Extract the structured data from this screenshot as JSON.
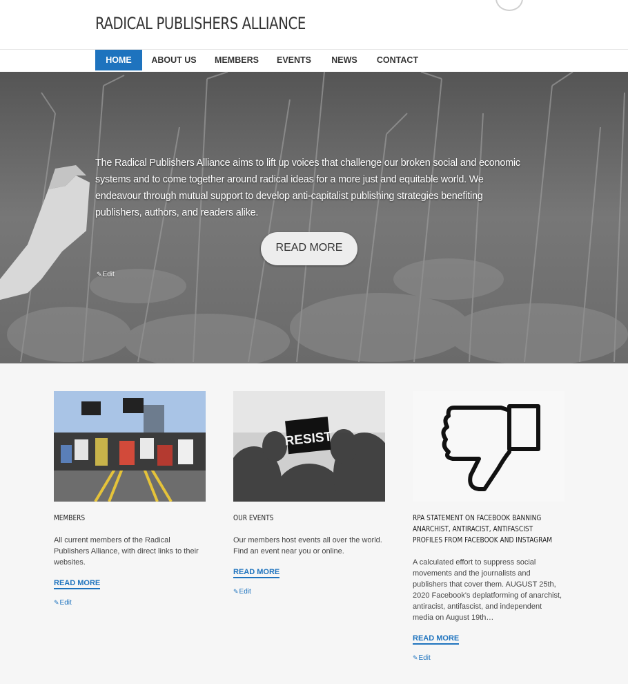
{
  "site": {
    "title": "RADICAL PUBLISHERS ALLIANCE"
  },
  "nav": {
    "items": [
      {
        "label": "HOME",
        "active": true
      },
      {
        "label": "ABOUT US"
      },
      {
        "label": "MEMBERS"
      },
      {
        "label": "EVENTS"
      },
      {
        "label": "NEWS"
      },
      {
        "label": "CONTACT"
      }
    ]
  },
  "hero": {
    "text": "The Radical Publishers Alliance aims to lift up voices that challenge our broken social and economic systems and to come together around radical ideas for a more just and equitable world. We endeavour through mutual support to develop anti-capitalist publishing strategies benefiting publishers, authors, and readers alike.",
    "button_label": "READ MORE",
    "edit_label": "Edit"
  },
  "cards": [
    {
      "title": "MEMBERS",
      "text": "All current members of the Radical Publishers Alliance, with direct links to their websites.",
      "read_more": "READ MORE",
      "edit": "Edit",
      "image_text": ""
    },
    {
      "title": "OUR EVENTS",
      "text": "Our members host events all over the world. Find an event near you or online.",
      "read_more": "READ MORE",
      "edit": "Edit",
      "image_text": "RESIST"
    },
    {
      "title": "RPA STATEMENT ON FACEBOOK BANNING ANARCHIST, ANTIRACIST, ANTIFASCIST PROFILES FROM FACEBOOK AND INSTAGRAM",
      "text": "A calculated effort to suppress social movements and the journalists and publishers that cover them. AUGUST 25th, 2020 Facebook's deplatforming of anarchist, antiracist, antifascist, and independent media on August 19th…",
      "read_more": "READ MORE",
      "edit": "Edit",
      "image_text": ""
    }
  ],
  "colors": {
    "accent": "#1e73be",
    "background": "#f6f6f6"
  }
}
